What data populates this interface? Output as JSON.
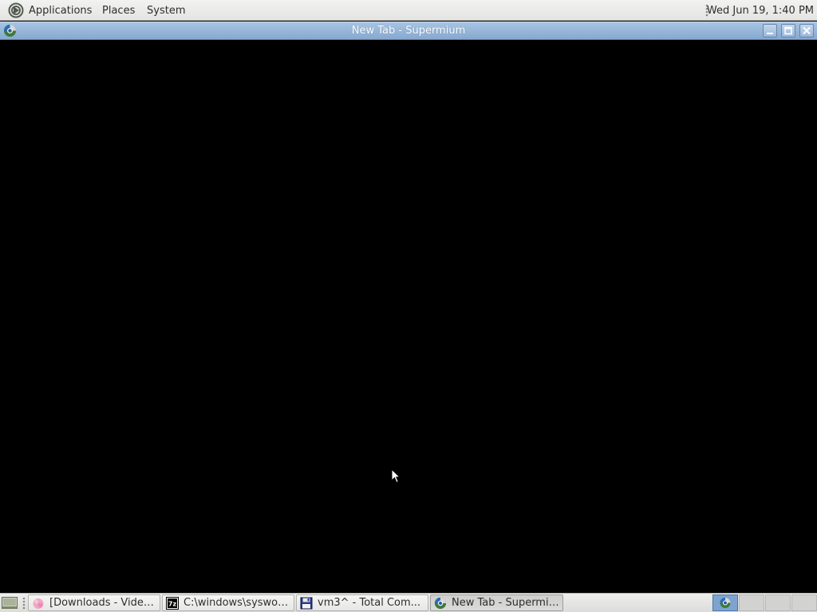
{
  "top_panel": {
    "menus": {
      "applications": "Applications",
      "places": "Places",
      "system": "System"
    },
    "clock": "Wed Jun 19,  1:40 PM"
  },
  "window": {
    "title": "New Tab - Supermium",
    "icon": "supermium-icon"
  },
  "taskbar": {
    "tasks": [
      {
        "label": "[Downloads - Video...",
        "icon": "video-player-icon"
      },
      {
        "label": "C:\\windows\\syswow...",
        "icon": "7zip-icon"
      },
      {
        "label": "vm3^ - Total Com...",
        "icon": "floppy-disk-icon"
      },
      {
        "label": "New Tab - Supermium",
        "icon": "supermium-icon"
      }
    ]
  },
  "colors": {
    "panel": "#e9e9e7",
    "titlebar": "#8fb0d6",
    "content": "#000000"
  }
}
